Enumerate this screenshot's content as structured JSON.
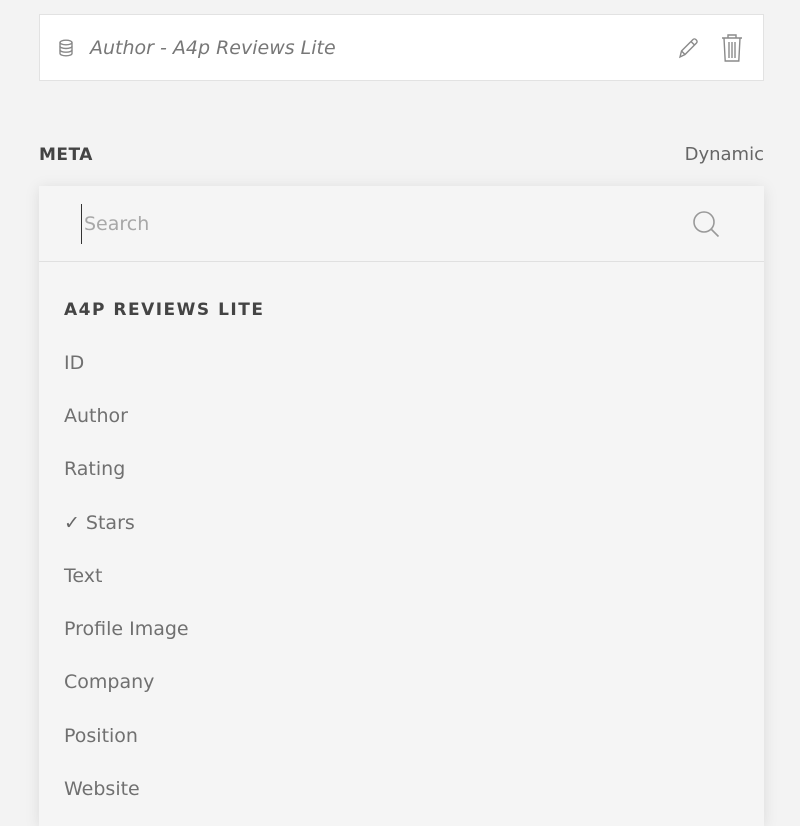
{
  "source": {
    "label": "Author - A4p Reviews Lite"
  },
  "meta": {
    "label": "META",
    "dynamic_label": "Dynamic"
  },
  "dropdown": {
    "search_placeholder": "Search",
    "group_title": "A4P REVIEWS LITE",
    "options": [
      {
        "label": "ID",
        "selected": false
      },
      {
        "label": "Author",
        "selected": false
      },
      {
        "label": "Rating",
        "selected": false
      },
      {
        "label": "Stars",
        "selected": true
      },
      {
        "label": "Text",
        "selected": false
      },
      {
        "label": "Profile Image",
        "selected": false
      },
      {
        "label": "Company",
        "selected": false
      },
      {
        "label": "Position",
        "selected": false
      },
      {
        "label": "Website",
        "selected": false
      }
    ],
    "check_glyph": "✓"
  },
  "icons": {
    "source": "database-icon",
    "edit": "pencil-icon",
    "delete": "trash-icon",
    "search": "search-icon"
  },
  "colors": {
    "background": "#f3f3f3",
    "card": "#ffffff",
    "text": "#707070",
    "heading": "#444444"
  }
}
